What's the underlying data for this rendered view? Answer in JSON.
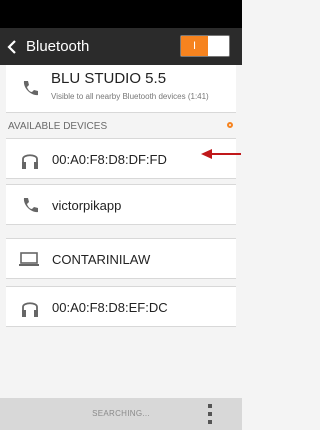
{
  "header": {
    "title": "Bluetooth",
    "back_icon": "chevron-left-icon",
    "toggle_label": "I",
    "accent": "#f6831f"
  },
  "paired_device": {
    "name": "BLU STUDIO 5.5",
    "subtitle": "Visible to all nearby Bluetooth devices (1:41)",
    "icon": "phone-icon"
  },
  "available": {
    "header": "AVAILABLE DEVICES",
    "devices": [
      {
        "name": "00:A0:F8:D8:DF:FD",
        "icon": "headphones-icon"
      },
      {
        "name": "victorpikapp",
        "icon": "phone-icon"
      },
      {
        "name": "CONTARINILAW",
        "icon": "laptop-icon"
      },
      {
        "name": "00:A0:F8:D8:EF:DC",
        "icon": "headphones-icon"
      }
    ]
  },
  "bottom_bar": {
    "status": "SEARCHING...",
    "menu_icon": "overflow-menu-icon"
  },
  "annotation": {
    "arrow_color": "#c0181a"
  }
}
